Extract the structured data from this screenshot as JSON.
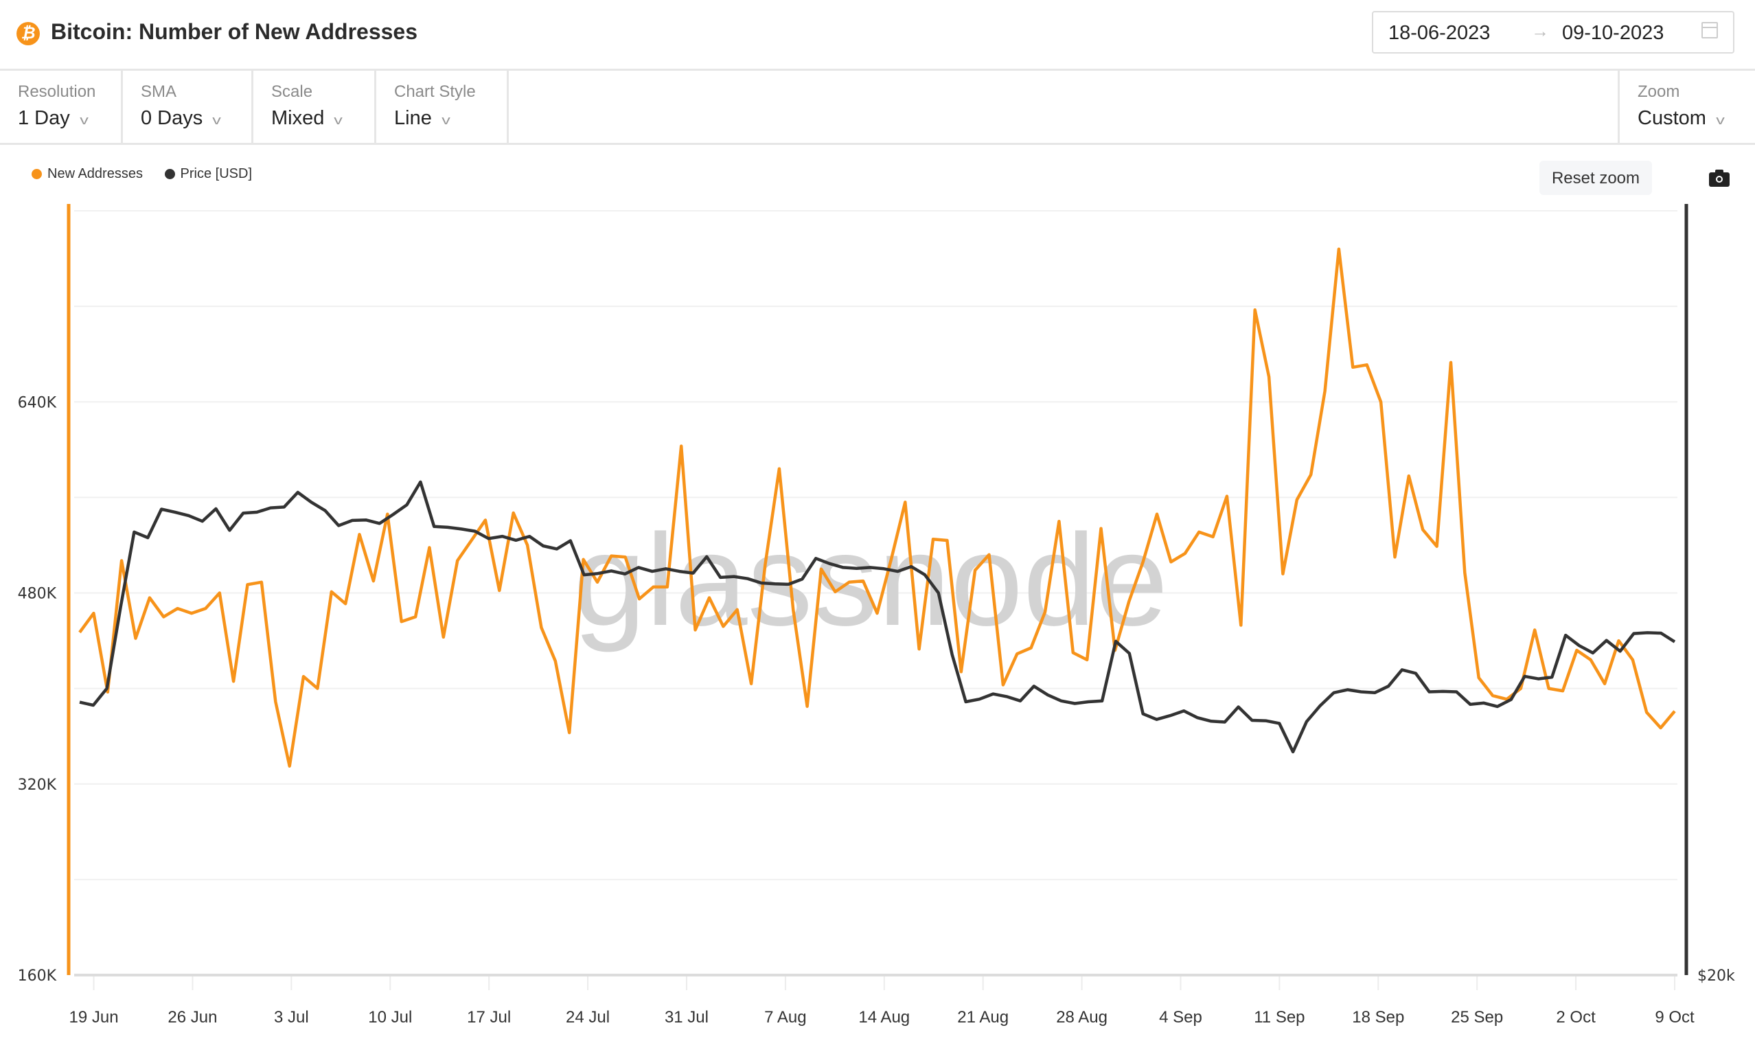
{
  "header": {
    "asset_icon": "bitcoin-icon",
    "title": "Bitcoin: Number of New Addresses",
    "date_from": "18-06-2023",
    "date_arrow": "→",
    "date_to": "09-10-2023",
    "calendar_icon": "calendar-icon"
  },
  "toolbar": {
    "resolution": {
      "label": "Resolution",
      "value": "1 Day"
    },
    "sma": {
      "label": "SMA",
      "value": "0 Days"
    },
    "scale": {
      "label": "Scale",
      "value": "Mixed"
    },
    "chart_style": {
      "label": "Chart Style",
      "value": "Line"
    },
    "zoom": {
      "label": "Zoom",
      "value": "Custom"
    },
    "chevron": "⌄"
  },
  "controls": {
    "reset_zoom": "Reset zoom",
    "screenshot_icon": "camera-icon"
  },
  "watermark": "glassnode",
  "colors": {
    "new_addresses": "#f7931a",
    "price": "#333333",
    "grid": "#f0f0f0"
  },
  "chart_data": {
    "type": "line",
    "title": "Bitcoin: Number of New Addresses",
    "xlabel": "",
    "ylabel": "",
    "legend_position": "top-left",
    "grid": true,
    "x_start": "2023-06-18",
    "x_end": "2023-10-09",
    "x_ticks": [
      "19 Jun",
      "26 Jun",
      "3 Jul",
      "10 Jul",
      "17 Jul",
      "24 Jul",
      "31 Jul",
      "7 Aug",
      "14 Aug",
      "21 Aug",
      "28 Aug",
      "4 Sep",
      "11 Sep",
      "18 Sep",
      "25 Sep",
      "2 Oct",
      "9 Oct"
    ],
    "y_left": {
      "ticks": [
        "160K",
        "320K",
        "480K",
        "640K"
      ],
      "tick_values": [
        160000,
        320000,
        480000,
        640000
      ],
      "range": [
        160000,
        800000
      ]
    },
    "y_right": {
      "ticks": [
        "$20k"
      ],
      "tick_values": [
        20000
      ],
      "range": [
        20000,
        37700
      ]
    },
    "series": [
      {
        "name": "New Addresses",
        "axis": "left",
        "values": [
          447000,
          463000,
          397000,
          507000,
          442000,
          476000,
          460000,
          467000,
          463000,
          467000,
          480000,
          406000,
          487000,
          489000,
          389000,
          335000,
          410000,
          400000,
          481000,
          471000,
          529000,
          490000,
          546000,
          456000,
          460000,
          518000,
          443000,
          507000,
          524000,
          541000,
          482000,
          547000,
          520000,
          451000,
          423000,
          363000,
          508000,
          489000,
          511000,
          510000,
          475000,
          485000,
          485000,
          603000,
          449000,
          476000,
          452000,
          466000,
          404000,
          504000,
          584000,
          466000,
          385000,
          500000,
          481000,
          489000,
          490000,
          463000,
          508000,
          556000,
          433000,
          525000,
          524000,
          414000,
          499000,
          512000,
          403000,
          429000,
          434000,
          464000,
          540000,
          430000,
          424000,
          534000,
          432000,
          473000,
          506000,
          546000,
          506000,
          513000,
          531000,
          527000,
          561000,
          453000,
          717000,
          661000,
          496000,
          558000,
          579000,
          649000,
          768000,
          669000,
          671000,
          640000,
          510000,
          578000,
          533000,
          519000,
          673000,
          497000,
          409000,
          394000,
          391000,
          400000,
          449000,
          400000,
          398000,
          432000,
          424000,
          404000,
          440000,
          424000,
          380000,
          367000,
          381000
        ],
        "color": "#f7931a"
      },
      {
        "name": "Price [USD]",
        "axis": "right",
        "values": [
          26320,
          26250,
          26640,
          28520,
          30260,
          30130,
          30790,
          30720,
          30640,
          30510,
          30800,
          30300,
          30700,
          30720,
          30820,
          30840,
          31180,
          30950,
          30760,
          30410,
          30530,
          30540,
          30460,
          30670,
          30890,
          31420,
          30390,
          30370,
          30330,
          30280,
          30110,
          30160,
          30070,
          30160,
          29940,
          29870,
          30060,
          29270,
          29300,
          29360,
          29290,
          29440,
          29350,
          29410,
          29350,
          29310,
          29690,
          29210,
          29230,
          29180,
          29080,
          29060,
          29050,
          29170,
          29650,
          29530,
          29440,
          29420,
          29440,
          29410,
          29350,
          29460,
          29270,
          28850,
          27420,
          26330,
          26390,
          26510,
          26450,
          26350,
          26690,
          26490,
          26350,
          26290,
          26330,
          26350,
          27730,
          27450,
          26050,
          25920,
          26010,
          26120,
          25960,
          25880,
          25860,
          26210,
          25900,
          25890,
          25830,
          25170,
          25870,
          26240,
          26540,
          26610,
          26560,
          26540,
          26690,
          27070,
          26990,
          26560,
          26570,
          26560,
          26270,
          26300,
          26220,
          26380,
          26920,
          26860,
          26900,
          27870,
          27630,
          27460,
          27750,
          27500,
          27910,
          27930,
          27920,
          27720
        ]
      }
    ]
  }
}
